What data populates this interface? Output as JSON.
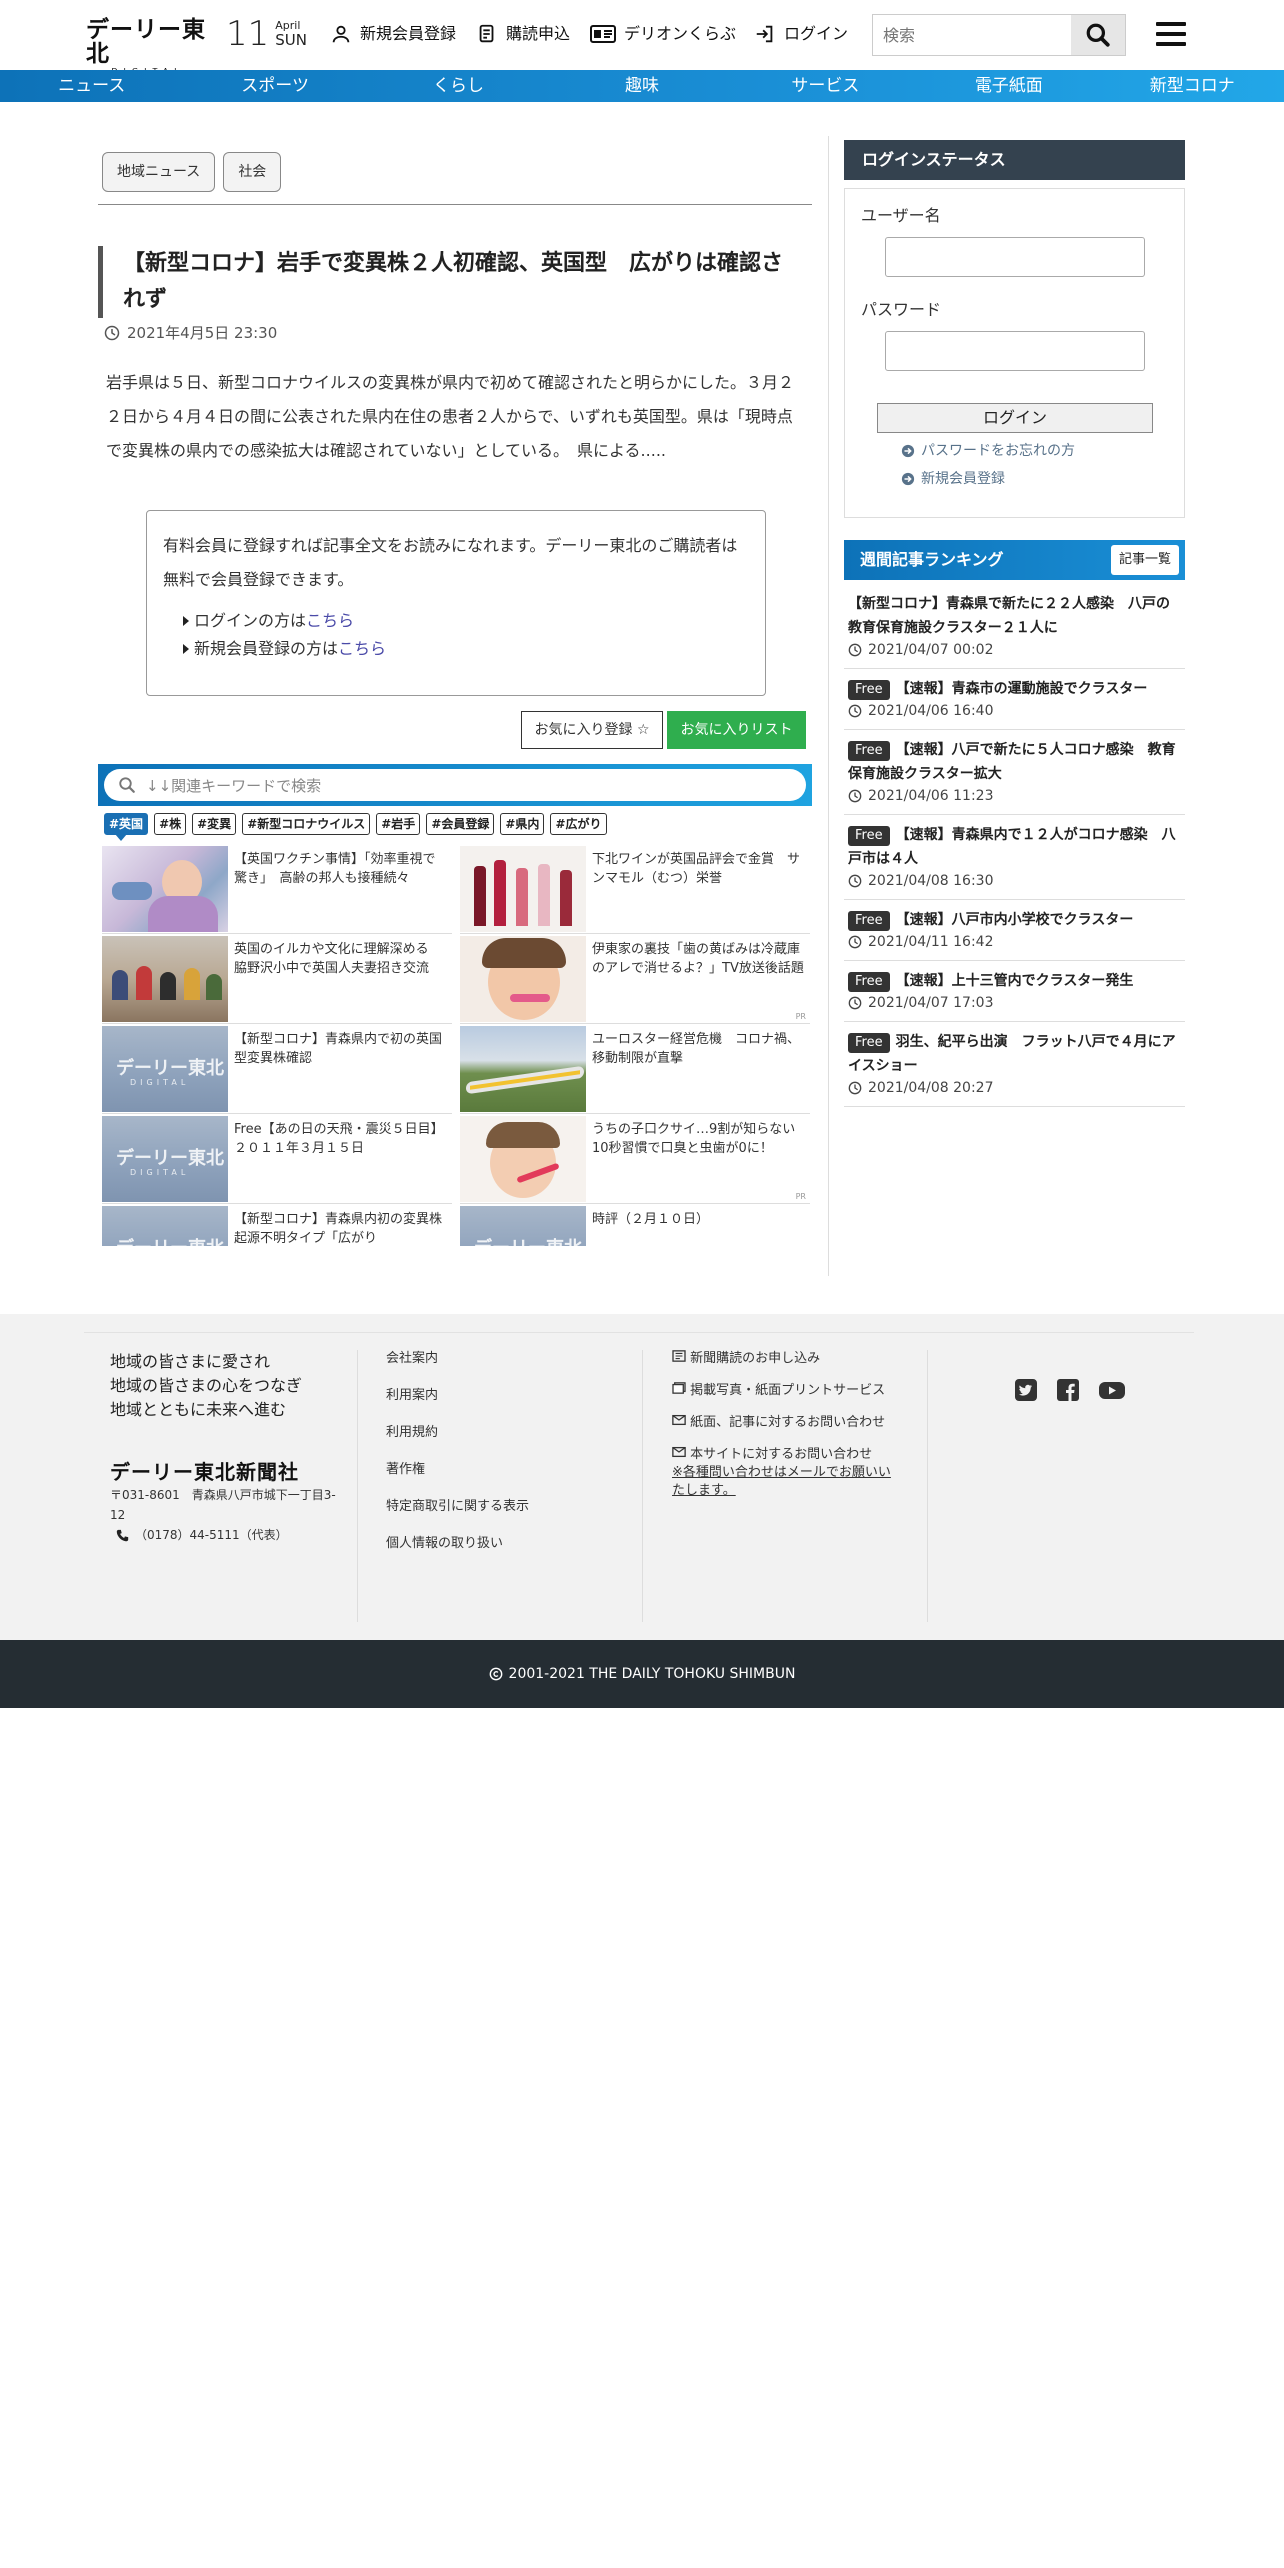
{
  "header": {
    "logo_main": "デーリー東北",
    "logo_sub": "DIGITAL",
    "date_day": "11",
    "date_month": "April",
    "date_weekday": "SUN",
    "nav": [
      {
        "label": "新規会員登録",
        "icon": "user-icon"
      },
      {
        "label": "購読申込",
        "icon": "receipt-icon"
      },
      {
        "label": "デリオンくらぶ",
        "icon": "id-card-icon"
      },
      {
        "label": "ログイン",
        "icon": "login-icon"
      }
    ],
    "search_placeholder": "検索"
  },
  "category_nav": [
    "ニュース",
    "スポーツ",
    "くらし",
    "趣味",
    "サービス",
    "電子紙面",
    "新型コロナ"
  ],
  "article": {
    "tags": [
      "地域ニュース",
      "社会"
    ],
    "title": "【新型コロナ】岩手で変異株２人初確認、英国型　広がりは確認されず",
    "date": "2021年4月5日 23:30",
    "lead": "岩手県は５日、新型コロナウイルスの変異株が県内で初めて確認されたと明らかにした。３月２２日から４月４日の間に公表された県内在住の患者２人からで、いずれも英国型。県は「現時点で変異株の県内での感染拡大は確認されていない」としている。　県による....."
  },
  "paywall": {
    "message": "有料会員に登録すれば記事全文をお読みになれます。デーリー東北のご購読者は無料で会員登録できます。",
    "login_prefix": "ログインの方は",
    "login_link": "こちら",
    "register_prefix": "新規会員登録の方は",
    "register_link": "こちら"
  },
  "favorites": {
    "add_label": "お気に入り登録",
    "add_star": "☆",
    "list_label": "お気に入りリスト"
  },
  "keywords": {
    "search_placeholder": "↓↓関連キーワードで検索",
    "tags": [
      "#英国",
      "#株",
      "#変異",
      "#新型コロナウイルス",
      "#岩手",
      "#会員登録",
      "#県内",
      "#広がり"
    ]
  },
  "related": [
    {
      "text": "【英国ワクチン事情】「効率重視で驚き」　高齢の邦人も接種続々",
      "thumb": "vaccine",
      "pr": false
    },
    {
      "text": "下北ワインが英国品評会で金賞　サンマモル（むつ）栄誉",
      "thumb": "wine",
      "pr": false
    },
    {
      "text": "英国のイルカや文化に理解深める　脇野沢小中で英国人夫妻招き交流",
      "thumb": "school",
      "pr": false
    },
    {
      "text": "伊東家の裏技「歯の黄ばみは冷蔵庫のアレで消せるよ？」TV放送後話題",
      "thumb": "child",
      "pr": true
    },
    {
      "text": "【新型コロナ】青森県内で初の英国型変異株確認",
      "thumb": "logo",
      "pr": false
    },
    {
      "text": "ユーロスター経営危機　コロナ禍、移動制限が直撃",
      "thumb": "train",
      "pr": false
    },
    {
      "text": "Free【あの日の天飛・震災５日目】２０１１年３月１５日",
      "thumb": "logo",
      "pr": false
    },
    {
      "text": "うちの子口クサイ…9割が知らない10秒習慣で口臭と虫歯が0に！",
      "thumb": "child2",
      "pr": true
    },
    {
      "text": "【新型コロナ】青森県内初の変異株　起源不明タイプ「広がり",
      "thumb": "logo",
      "pr": false
    },
    {
      "text": "時評（２月１０日）",
      "thumb": "logo",
      "pr": false
    }
  ],
  "pr_label": "PR",
  "logo_placeholder": {
    "main": "デーリー東北",
    "sub": "DIGITAL"
  },
  "login_status": {
    "heading": "ログインステータス",
    "username_label": "ユーザー名",
    "password_label": "パスワード",
    "login_button": "ログイン",
    "forgot_link": "パスワードをお忘れの方",
    "register_link": "新規会員登録"
  },
  "ranking": {
    "heading": "週間記事ランキング",
    "all_button": "記事一覧",
    "free_label": "Free",
    "items": [
      {
        "free": false,
        "title": "【新型コロナ】青森県で新たに２２人感染　八戸の教育保育施設クラスター２１人に",
        "date": "2021/04/07 00:02"
      },
      {
        "free": true,
        "title": "【速報】青森市の運動施設でクラスター",
        "date": "2021/04/06 16:40"
      },
      {
        "free": true,
        "title": "【速報】八戸で新たに５人コロナ感染　教育保育施設クラスター拡大",
        "date": "2021/04/06 11:23"
      },
      {
        "free": true,
        "title": "【速報】青森県内で１２人がコロナ感染　八戸市は４人",
        "date": "2021/04/08 16:30"
      },
      {
        "free": true,
        "title": "【速報】八戸市内小学校でクラスター",
        "date": "2021/04/11 16:42"
      },
      {
        "free": true,
        "title": "【速報】上十三管内でクラスター発生",
        "date": "2021/04/07 17:03"
      },
      {
        "free": true,
        "title": "羽生、紀平ら出演　フラット八戸で４月にアイスショー",
        "date": "2021/04/08 20:27"
      }
    ]
  },
  "footer": {
    "motto": [
      "地域の皆さまに愛され",
      "地域の皆さまの心をつなぎ",
      "地域とともに未来へ進む"
    ],
    "company": "デーリー東北新聞社",
    "address": "〒031-8601　青森県八戸市城下一丁目3-12",
    "tel": "（0178）44-5111（代表）",
    "links_col1": [
      "会社案内",
      "利用案内",
      "利用規約",
      "著作権",
      "特定商取引に関する表示",
      "個人情報の取り扱い"
    ],
    "links_col2": [
      {
        "label": "新聞購読のお申し込み",
        "icon": "newspaper-icon"
      },
      {
        "label": "掲載写真・紙面プリントサービス",
        "icon": "print-icon"
      },
      {
        "label": "紙面、記事に対するお問い合わせ",
        "icon": "mail-icon"
      },
      {
        "label": "本サイトに対するお問い合わせ",
        "icon": "mail-icon"
      }
    ],
    "note": "※各種問い合わせはメールでお願いいたします。",
    "social": [
      "twitter-icon",
      "facebook-icon",
      "youtube-icon"
    ],
    "copyright": "2001-2021 THE DAILY TOHOKU SHIMBUN"
  },
  "colors": {
    "nav_blue": "#0d72b8",
    "sidebar_dark": "#34424f",
    "fav_green": "#2fae4e",
    "footer_dark": "#252d33"
  }
}
